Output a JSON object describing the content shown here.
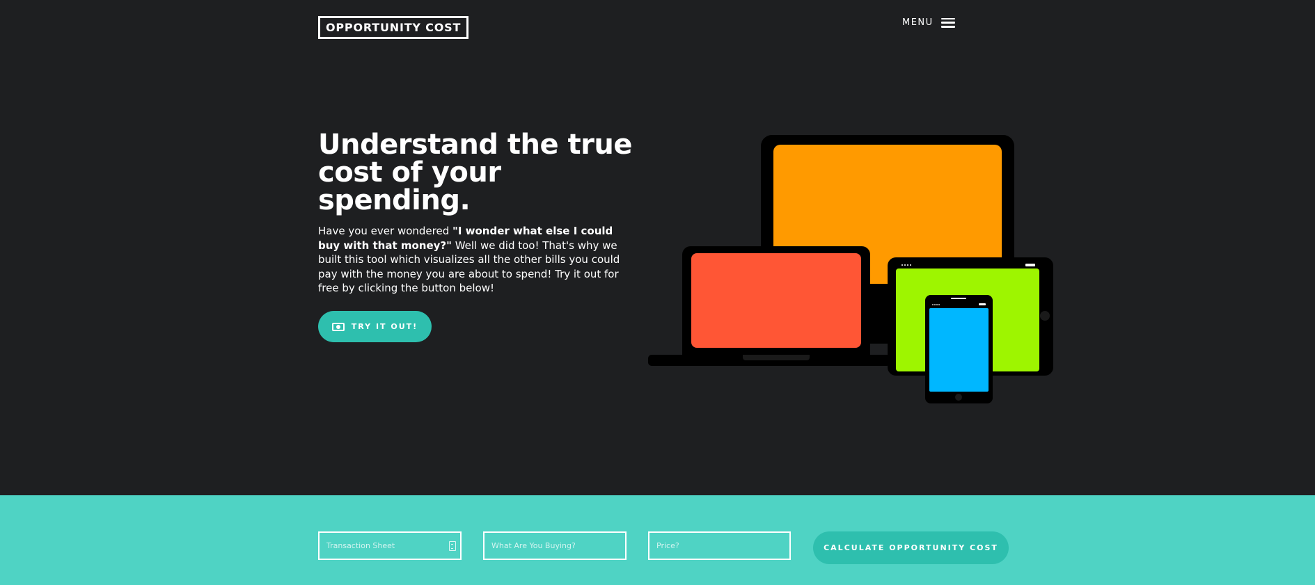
{
  "header": {
    "brand": "OPPORTUNITY COST",
    "menu_label": "MENU"
  },
  "hero": {
    "title": "Understand the true cost of your spending.",
    "intro_prefix": "Have you ever wondered ",
    "intro_quote": "\"I wonder what else I could buy with that money?\"",
    "intro_suffix": " Well we did too! That's why we built this tool which visualizes all the other bills you could pay with the money you are about to spend! Try it out for free by clicking the button below!",
    "cta_label": "TRY IT OUT!"
  },
  "form": {
    "transaction_placeholder": "Transaction Sheet",
    "item_placeholder": "What Are You Buying?",
    "price_placeholder": "Price?",
    "submit_label": "CALCULATE OPPORTUNITY COST"
  },
  "colors": {
    "background": "#1e1f21",
    "accent": "#2ebfae",
    "band": "#4fd3c4",
    "monitor_screen": "#ff9a00",
    "laptop_screen": "#ff5635",
    "tablet_screen": "#9ef500",
    "phone_screen": "#00b7ff"
  },
  "icons": {
    "menu": "hamburger-icon",
    "cta": "money-bill-icon",
    "file": "file-icon"
  }
}
